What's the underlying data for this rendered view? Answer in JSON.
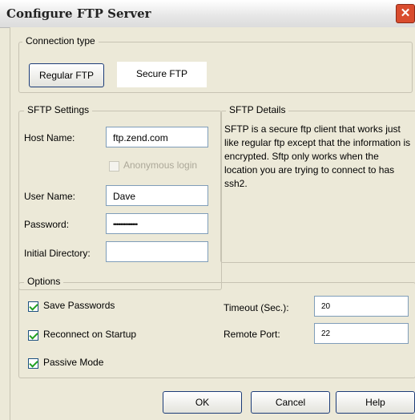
{
  "window": {
    "title": "Configure FTP Server",
    "close_icon": "close-icon"
  },
  "connection_type": {
    "legend": "Connection type",
    "regular_ftp": "Regular FTP",
    "secure_ftp": "Secure FTP"
  },
  "sftp_settings": {
    "legend": "SFTP Settings",
    "host_name_label": "Host Name:",
    "host_name_value": "ftp.zend.com",
    "anonymous_label": "Anonymous login",
    "user_name_label": "User Name:",
    "user_name_value": "Dave",
    "password_label": "Password:",
    "password_value": "••••••••••••••",
    "initial_dir_label": "Initial Directory:",
    "initial_dir_value": ""
  },
  "sftp_details": {
    "legend": "SFTP Details",
    "text": "SFTP is a secure ftp client that works just like regular ftp except that the information is encrypted. Sftp only works when the location you are trying to connect to has ssh2."
  },
  "options": {
    "legend": "Options",
    "save_passwords": "Save Passwords",
    "reconnect": "Reconnect on Startup",
    "passive_mode": "Passive Mode",
    "timeout_label": "Timeout (Sec.):",
    "timeout_value": "20",
    "remote_port_label": "Remote Port:",
    "remote_port_value": "22"
  },
  "buttons": {
    "ok": "OK",
    "cancel": "Cancel",
    "help": "Help"
  }
}
